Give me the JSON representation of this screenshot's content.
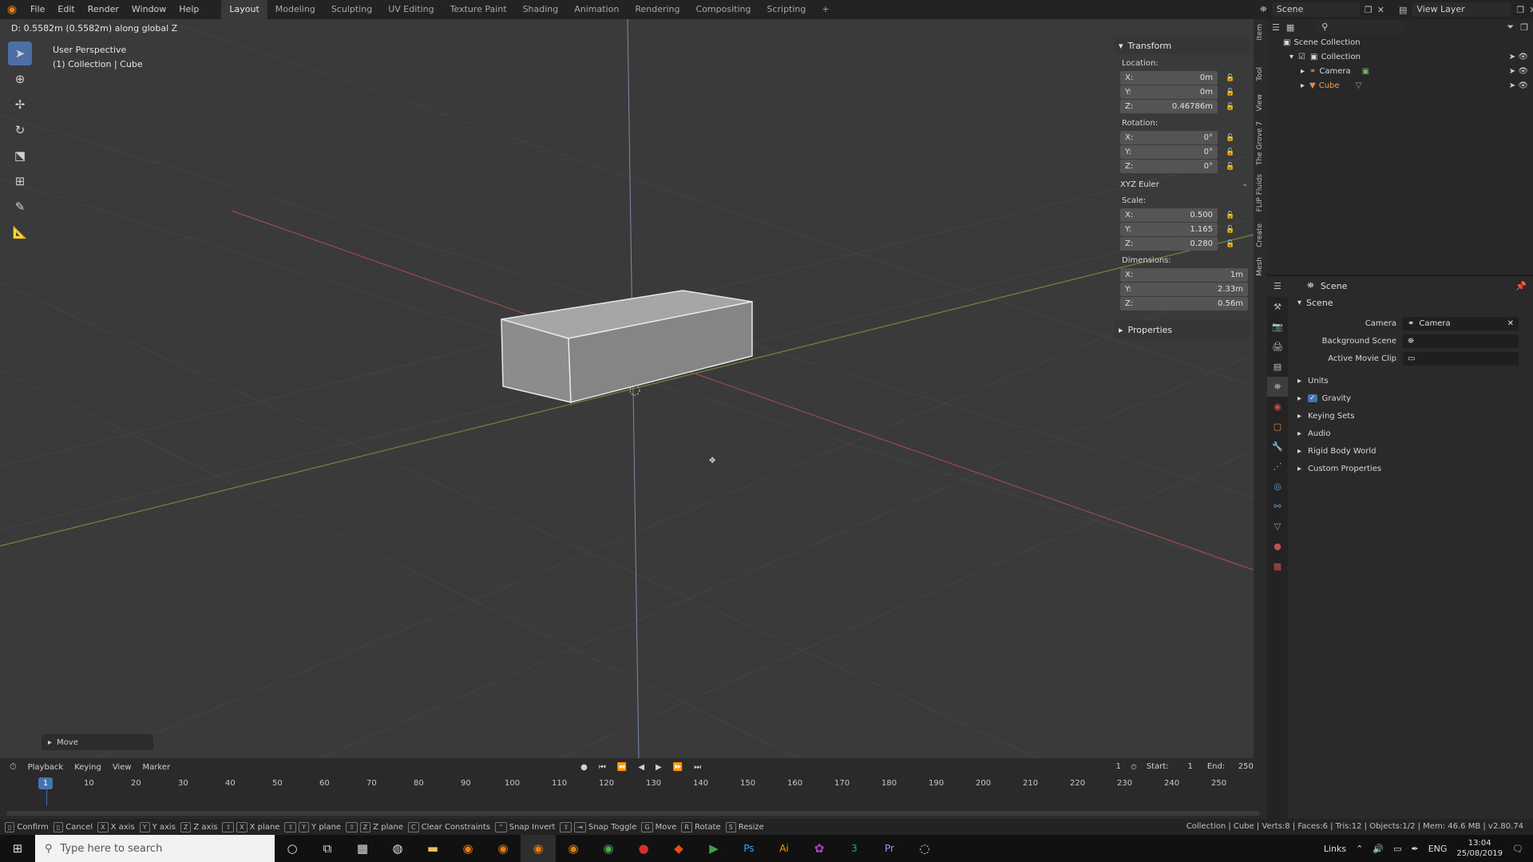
{
  "topbar": {
    "menus": [
      "File",
      "Edit",
      "Render",
      "Window",
      "Help"
    ],
    "workspaces": [
      "Layout",
      "Modeling",
      "Sculpting",
      "UV Editing",
      "Texture Paint",
      "Shading",
      "Animation",
      "Rendering",
      "Compositing",
      "Scripting"
    ],
    "active_workspace": "Layout",
    "add_tab": "+",
    "scene_label": "Scene",
    "view_layer_label": "View Layer"
  },
  "viewport": {
    "header_info": "D: 0.5582m (0.5582m) along global Z",
    "perspective": "User Perspective",
    "collection_info": "(1) Collection | Cube",
    "move_panel": "Move"
  },
  "npanel": {
    "transform_title": "Transform",
    "location_label": "Location:",
    "location": [
      {
        "axis": "X:",
        "value": "0m"
      },
      {
        "axis": "Y:",
        "value": "0m"
      },
      {
        "axis": "Z:",
        "value": "0.46786m"
      }
    ],
    "rotation_label": "Rotation:",
    "rotation": [
      {
        "axis": "X:",
        "value": "0°"
      },
      {
        "axis": "Y:",
        "value": "0°"
      },
      {
        "axis": "Z:",
        "value": "0°"
      }
    ],
    "rotation_mode": "XYZ Euler",
    "scale_label": "Scale:",
    "scale": [
      {
        "axis": "X:",
        "value": "0.500"
      },
      {
        "axis": "Y:",
        "value": "1.165"
      },
      {
        "axis": "Z:",
        "value": "0.280"
      }
    ],
    "dimensions_label": "Dimensions:",
    "dimensions": [
      {
        "axis": "X:",
        "value": "1m"
      },
      {
        "axis": "Y:",
        "value": "2.33m"
      },
      {
        "axis": "Z:",
        "value": "0.56m"
      }
    ],
    "properties_title": "Properties"
  },
  "vtabs": [
    "Item",
    "Tool",
    "View",
    "The Grove 7",
    "FLIP Fluids",
    "Create",
    "Mesh"
  ],
  "outliner": {
    "root": "Scene Collection",
    "collection": "Collection",
    "camera": "Camera",
    "cube": "Cube"
  },
  "properties": {
    "header": "Scene",
    "section": "Scene",
    "camera_label": "Camera",
    "camera_value": "Camera",
    "background_label": "Background Scene",
    "movie_label": "Active Movie Clip",
    "subsections": [
      "Units",
      "Gravity",
      "Keying Sets",
      "Audio",
      "Rigid Body World",
      "Custom Properties"
    ]
  },
  "timeline": {
    "menus": [
      "Playback",
      "Keying",
      "View",
      "Marker"
    ],
    "current_frame": "1",
    "start_label": "Start:",
    "start": "1",
    "end_label": "End:",
    "end": "250",
    "ticks": [
      "10",
      "20",
      "30",
      "40",
      "50",
      "60",
      "70",
      "80",
      "90",
      "100",
      "110",
      "120",
      "130",
      "140",
      "150",
      "160",
      "170",
      "180",
      "190",
      "200",
      "210",
      "220",
      "230",
      "240",
      "250"
    ]
  },
  "status": {
    "items": [
      {
        "key": "",
        "label": "Confirm"
      },
      {
        "key": "",
        "label": "Cancel"
      },
      {
        "key": "X",
        "label": "X axis"
      },
      {
        "key": "Y",
        "label": "Y axis"
      },
      {
        "key": "Z",
        "label": "Z axis"
      },
      {
        "key": "X",
        "label": "X plane"
      },
      {
        "key": "Y",
        "label": "Y plane"
      },
      {
        "key": "Z",
        "label": "Z plane"
      },
      {
        "key": "C",
        "label": "Clear Constraints"
      },
      {
        "key": "",
        "label": "Snap Invert"
      },
      {
        "key": "",
        "label": "Snap Toggle"
      },
      {
        "key": "G",
        "label": "Move"
      },
      {
        "key": "R",
        "label": "Rotate"
      },
      {
        "key": "S",
        "label": "Resize"
      }
    ],
    "right_info": "Collection | Cube | Verts:8 | Faces:6 | Tris:12 | Objects:1/2 | Mem: 46.6 MB | v2.80.74"
  },
  "taskbar": {
    "search_placeholder": "Type here to search",
    "links": "Links",
    "lang": "ENG",
    "time": "13:04",
    "date": "25/08/2019"
  },
  "colors": {
    "accent": "#4772b3",
    "blender_orange": "#e87d0d",
    "axis_x": "#a24848",
    "axis_y": "#6f8a3a",
    "axis_z": "#5a78b0"
  }
}
